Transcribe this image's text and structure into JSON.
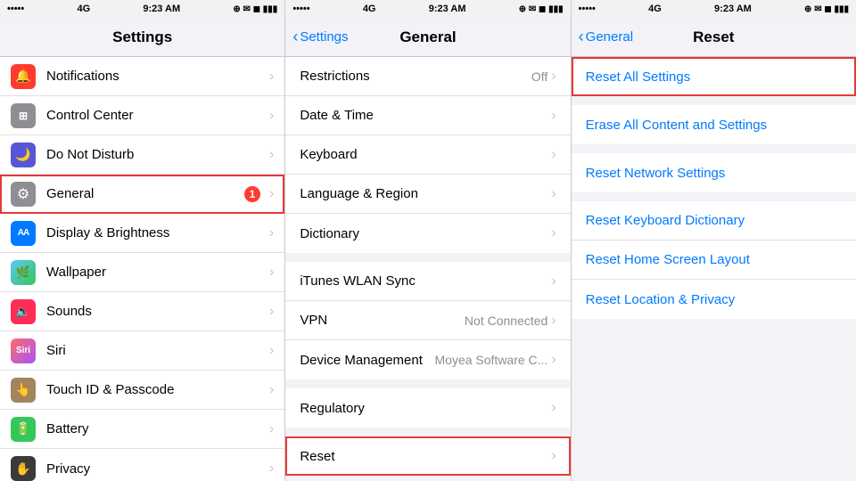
{
  "statusBar": {
    "signal": "•••••",
    "carrier": "4G",
    "time": "9:23 AM",
    "icons": "⊕ ✉ ◼",
    "battery": "■■■"
  },
  "col1": {
    "title": "Settings",
    "items": [
      {
        "id": "notifications",
        "label": "Notifications",
        "icon": "🔔",
        "iconColor": "icon-red",
        "value": "",
        "highlighted": false
      },
      {
        "id": "control-center",
        "label": "Control Center",
        "icon": "⊞",
        "iconColor": "icon-gray",
        "value": "",
        "highlighted": false
      },
      {
        "id": "do-not-disturb",
        "label": "Do Not Disturb",
        "icon": "🌙",
        "iconColor": "icon-purple",
        "value": "",
        "highlighted": false
      },
      {
        "id": "general",
        "label": "General",
        "icon": "⚙",
        "iconColor": "icon-gray",
        "badge": "1",
        "highlighted": true
      },
      {
        "id": "display-brightness",
        "label": "Display & Brightness",
        "icon": "AA",
        "iconColor": "icon-blue",
        "value": "",
        "highlighted": false
      },
      {
        "id": "wallpaper",
        "label": "Wallpaper",
        "icon": "🌿",
        "iconColor": "icon-teal",
        "value": "",
        "highlighted": false
      },
      {
        "id": "sounds",
        "label": "Sounds",
        "icon": "🔈",
        "iconColor": "icon-pink",
        "value": "",
        "highlighted": false
      },
      {
        "id": "siri",
        "label": "Siri",
        "icon": "◎",
        "iconColor": "icon-gray",
        "value": "",
        "highlighted": false
      },
      {
        "id": "touch-id",
        "label": "Touch ID & Passcode",
        "icon": "👆",
        "iconColor": "icon-brown",
        "value": "",
        "highlighted": false
      },
      {
        "id": "battery",
        "label": "Battery",
        "icon": "🔋",
        "iconColor": "icon-green",
        "value": "",
        "highlighted": false
      },
      {
        "id": "privacy",
        "label": "Privacy",
        "icon": "✋",
        "iconColor": "icon-dark",
        "value": "",
        "highlighted": false
      }
    ]
  },
  "col2": {
    "title": "General",
    "backLabel": "Settings",
    "sections": [
      {
        "items": [
          {
            "id": "restrictions",
            "label": "Restrictions",
            "value": "Off",
            "highlighted": false
          },
          {
            "id": "date-time",
            "label": "Date & Time",
            "value": "",
            "highlighted": false
          },
          {
            "id": "keyboard",
            "label": "Keyboard",
            "value": "",
            "highlighted": false
          },
          {
            "id": "language-region",
            "label": "Language & Region",
            "value": "",
            "highlighted": false
          },
          {
            "id": "dictionary",
            "label": "Dictionary",
            "value": "",
            "highlighted": false
          }
        ]
      },
      {
        "items": [
          {
            "id": "itunes-wlan",
            "label": "iTunes WLAN Sync",
            "value": "",
            "highlighted": false
          },
          {
            "id": "vpn",
            "label": "VPN",
            "value": "Not Connected",
            "highlighted": false
          },
          {
            "id": "device-management",
            "label": "Device Management",
            "value": "Moyea Software C...",
            "highlighted": false
          }
        ]
      },
      {
        "items": [
          {
            "id": "regulatory",
            "label": "Regulatory",
            "value": "",
            "highlighted": false
          }
        ]
      },
      {
        "items": [
          {
            "id": "reset",
            "label": "Reset",
            "value": "",
            "highlighted": true
          }
        ]
      }
    ]
  },
  "col3": {
    "title": "Reset",
    "backLabel": "General",
    "sections": [
      {
        "items": [
          {
            "id": "reset-all",
            "label": "Reset All Settings",
            "highlighted": true
          }
        ]
      },
      {
        "items": [
          {
            "id": "erase-all",
            "label": "Erase All Content and Settings",
            "highlighted": false
          }
        ]
      },
      {
        "items": [
          {
            "id": "reset-network",
            "label": "Reset Network Settings",
            "highlighted": false
          }
        ]
      },
      {
        "items": [
          {
            "id": "reset-keyboard",
            "label": "Reset Keyboard Dictionary",
            "highlighted": false
          },
          {
            "id": "reset-home",
            "label": "Reset Home Screen Layout",
            "highlighted": false
          },
          {
            "id": "reset-location",
            "label": "Reset Location & Privacy",
            "highlighted": false
          }
        ]
      }
    ]
  }
}
